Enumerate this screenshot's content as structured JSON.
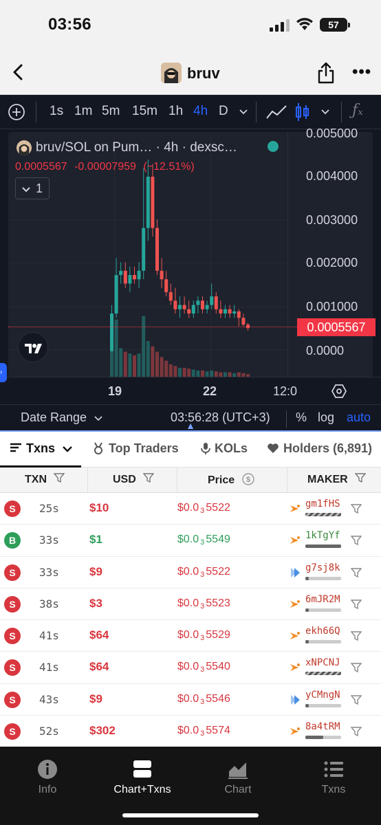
{
  "status": {
    "time": "03:56",
    "battery": "57"
  },
  "nav": {
    "title": "bruv"
  },
  "toolbar": {
    "intervals": [
      "1s",
      "1m",
      "5m",
      "15m",
      "1h",
      "4h",
      "D"
    ],
    "active_interval": "4h"
  },
  "chart": {
    "legend_title": "bruv/SOL on Pum…  · 4h · dexsc…",
    "last_price": "0.0005567",
    "change_abs": "-0.00007959",
    "change_pct": "(−12.51%)",
    "collapse_label": "1",
    "y_labels": [
      "0.005000",
      "0.004000",
      "0.003000",
      "0.002000",
      "0.001000",
      "0.0000"
    ],
    "price_tag": "0.0005567",
    "x_labels": [
      "19",
      "22",
      "12:0"
    ],
    "colors": {
      "up": "#26a69a",
      "down": "#ef5350"
    }
  },
  "chart_data": {
    "type": "candlestick",
    "y_unit": "SOL",
    "ylim": [
      0,
      0.005
    ],
    "candles": [
      {
        "o": 2e-05,
        "h": 0.0011,
        "l": 1e-05,
        "c": 0.0009
      },
      {
        "o": 0.0009,
        "h": 0.0022,
        "l": 0.0008,
        "c": 0.0018
      },
      {
        "o": 0.0018,
        "h": 0.0021,
        "l": 0.0016,
        "c": 0.0019
      },
      {
        "o": 0.0019,
        "h": 0.0021,
        "l": 0.0015,
        "c": 0.0016
      },
      {
        "o": 0.0016,
        "h": 0.002,
        "l": 0.0014,
        "c": 0.0018
      },
      {
        "o": 0.0018,
        "h": 0.002,
        "l": 0.0016,
        "c": 0.0017
      },
      {
        "o": 0.0017,
        "h": 0.0021,
        "l": 0.0015,
        "c": 0.0019
      },
      {
        "o": 0.0019,
        "h": 0.0043,
        "l": 0.0017,
        "c": 0.0029
      },
      {
        "o": 0.0029,
        "h": 0.0045,
        "l": 0.0026,
        "c": 0.0041
      },
      {
        "o": 0.0041,
        "h": 0.0044,
        "l": 0.0027,
        "c": 0.0029
      },
      {
        "o": 0.0029,
        "h": 0.0031,
        "l": 0.0018,
        "c": 0.0019
      },
      {
        "o": 0.0019,
        "h": 0.0022,
        "l": 0.0015,
        "c": 0.0017
      },
      {
        "o": 0.0017,
        "h": 0.0019,
        "l": 0.0013,
        "c": 0.0014
      },
      {
        "o": 0.0014,
        "h": 0.0016,
        "l": 0.0011,
        "c": 0.0012
      },
      {
        "o": 0.0012,
        "h": 0.0015,
        "l": 0.0009,
        "c": 0.001
      },
      {
        "o": 0.001,
        "h": 0.0013,
        "l": 0.0008,
        "c": 0.0011
      },
      {
        "o": 0.0011,
        "h": 0.0013,
        "l": 0.0009,
        "c": 0.001
      },
      {
        "o": 0.001,
        "h": 0.0012,
        "l": 0.0008,
        "c": 0.0009
      },
      {
        "o": 0.0009,
        "h": 0.0012,
        "l": 0.0008,
        "c": 0.0011
      },
      {
        "o": 0.0011,
        "h": 0.0013,
        "l": 0.0009,
        "c": 0.0012
      },
      {
        "o": 0.0012,
        "h": 0.0013,
        "l": 0.0009,
        "c": 0.001
      },
      {
        "o": 0.001,
        "h": 0.0012,
        "l": 0.0009,
        "c": 0.0011
      },
      {
        "o": 0.0011,
        "h": 0.0016,
        "l": 0.001,
        "c": 0.0013
      },
      {
        "o": 0.0013,
        "h": 0.0014,
        "l": 0.0009,
        "c": 0.001
      },
      {
        "o": 0.001,
        "h": 0.0012,
        "l": 0.0008,
        "c": 0.0009
      },
      {
        "o": 0.0009,
        "h": 0.0011,
        "l": 0.0008,
        "c": 0.001
      },
      {
        "o": 0.001,
        "h": 0.0011,
        "l": 0.0008,
        "c": 0.0009
      },
      {
        "o": 0.0009,
        "h": 0.0011,
        "l": 0.0008,
        "c": 0.00095
      },
      {
        "o": 0.00095,
        "h": 0.001,
        "l": 0.0006,
        "c": 0.0008
      },
      {
        "o": 0.0008,
        "h": 0.0009,
        "l": 0.0006,
        "c": 0.00064
      },
      {
        "o": 0.00064,
        "h": 0.00068,
        "l": 0.0005,
        "c": 0.00056
      }
    ],
    "volumes": [
      2.2,
      3.2,
      1.6,
      1.4,
      1.3,
      1.2,
      1.3,
      3.4,
      2.0,
      1.7,
      1.4,
      1.1,
      0.9,
      0.7,
      0.6,
      0.5,
      0.5,
      0.45,
      0.4,
      0.35,
      0.35,
      0.3,
      0.35,
      0.3,
      0.25,
      0.25,
      0.25,
      0.2,
      0.25,
      0.2,
      0.15
    ]
  },
  "bottombar": {
    "date_range": "Date Range",
    "clock": "03:56:28 (UTC+3)",
    "pct": "%",
    "log": "log",
    "auto": "auto"
  },
  "tabs": [
    {
      "label": "Txns"
    },
    {
      "label": "Top Traders"
    },
    {
      "label": "KOLs"
    },
    {
      "label": "Holders (6,891)"
    }
  ],
  "table": {
    "headers": {
      "txn": "TXN",
      "usd": "USD",
      "price": "Price",
      "maker": "MAKER"
    },
    "rows": [
      {
        "type": "S",
        "age": "25s",
        "usd": "$10",
        "p1": "$0.0",
        "p2": "3",
        "p3": "5522",
        "maker": "gm1fHS",
        "icon": "orange",
        "fill": 0.0,
        "hatched": true
      },
      {
        "type": "B",
        "age": "33s",
        "usd": "$1",
        "p1": "$0.0",
        "p2": "3",
        "p3": "5549",
        "maker": "1kTgYf",
        "icon": "orange",
        "fill": 1.0,
        "hatched": false
      },
      {
        "type": "S",
        "age": "33s",
        "usd": "$9",
        "p1": "$0.0",
        "p2": "3",
        "p3": "5522",
        "maker": "g7sj8k",
        "icon": "blue",
        "fill": 0.1,
        "hatched": false
      },
      {
        "type": "S",
        "age": "38s",
        "usd": "$3",
        "p1": "$0.0",
        "p2": "3",
        "p3": "5523",
        "maker": "6mJR2M",
        "icon": "orange",
        "fill": 0.1,
        "hatched": false
      },
      {
        "type": "S",
        "age": "41s",
        "usd": "$64",
        "p1": "$0.0",
        "p2": "3",
        "p3": "5529",
        "maker": "ekh66Q",
        "icon": "orange",
        "fill": 0.1,
        "hatched": false
      },
      {
        "type": "S",
        "age": "41s",
        "usd": "$64",
        "p1": "$0.0",
        "p2": "3",
        "p3": "5540",
        "maker": "xNPCNJ",
        "icon": "orange",
        "fill": 0.0,
        "hatched": true
      },
      {
        "type": "S",
        "age": "43s",
        "usd": "$9",
        "p1": "$0.0",
        "p2": "3",
        "p3": "5546",
        "maker": "yCMngN",
        "icon": "blue",
        "fill": 0.1,
        "hatched": false
      },
      {
        "type": "S",
        "age": "52s",
        "usd": "$302",
        "p1": "$0.0",
        "p2": "3",
        "p3": "5574",
        "maker": "8a4tRM",
        "icon": "orange",
        "fill": 0.5,
        "hatched": false
      }
    ]
  },
  "tabbar": [
    {
      "label": "Info",
      "icon": "info-icon"
    },
    {
      "label": "Chart+Txns",
      "icon": "split-view-icon"
    },
    {
      "label": "Chart",
      "icon": "chart-area-icon"
    },
    {
      "label": "Txns",
      "icon": "list-icon"
    }
  ]
}
